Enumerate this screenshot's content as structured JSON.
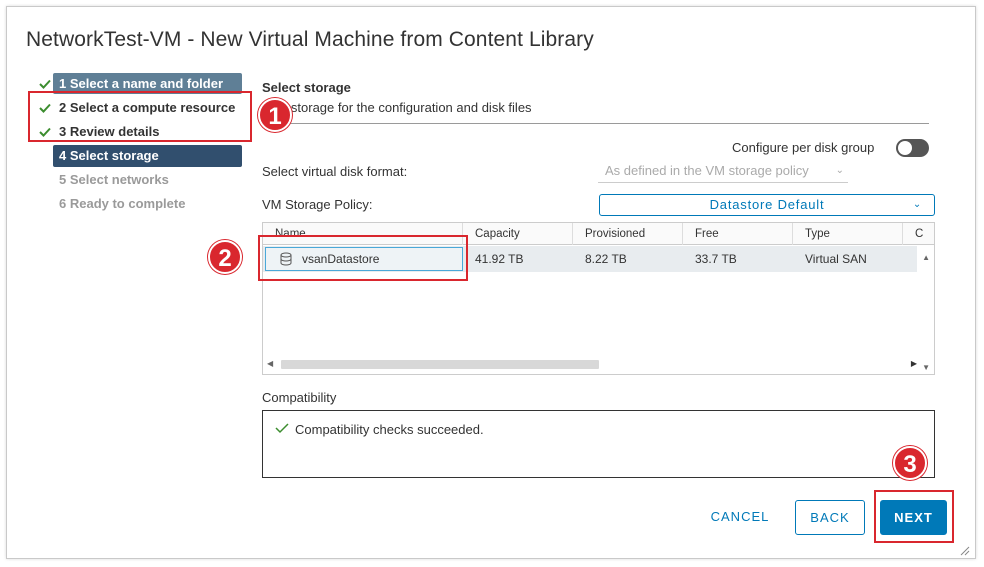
{
  "dialog": {
    "title": "NetworkTest-VM - New Virtual Machine from Content Library"
  },
  "steps": [
    {
      "label": "1 Select a name and folder",
      "state": "done"
    },
    {
      "label": "2 Select a compute resource",
      "state": "done"
    },
    {
      "label": "3 Review details",
      "state": "done"
    },
    {
      "label": "4 Select storage",
      "state": "current"
    },
    {
      "label": "5 Select networks",
      "state": "future"
    },
    {
      "label": "6 Ready to complete",
      "state": "future"
    }
  ],
  "storage": {
    "title": "Select storage",
    "subtitle": "t the storage for the configuration and disk files",
    "per_disk_label": "Configure per disk group",
    "per_disk_enabled": false,
    "disk_format_label": "Select virtual disk format:",
    "disk_format_value": "As defined in the VM storage policy",
    "policy_label": "VM Storage Policy:",
    "policy_value": "Datastore Default"
  },
  "table": {
    "columns": [
      "Name",
      "Capacity",
      "Provisioned",
      "Free",
      "Type",
      "C"
    ],
    "rows": [
      {
        "name": "vsanDatastore",
        "capacity": "41.92 TB",
        "provisioned": "8.22 TB",
        "free": "33.7 TB",
        "type": "Virtual SAN"
      }
    ]
  },
  "compatibility": {
    "label": "Compatibility",
    "message": "Compatibility checks succeeded."
  },
  "buttons": {
    "cancel": "CANCEL",
    "back": "BACK",
    "next": "NEXT"
  },
  "annotations": {
    "badge1": "1",
    "badge2": "2",
    "badge3": "3"
  },
  "colors": {
    "accent": "#0079b8",
    "current_step": "#314f6e",
    "annotation": "#d9272e"
  }
}
